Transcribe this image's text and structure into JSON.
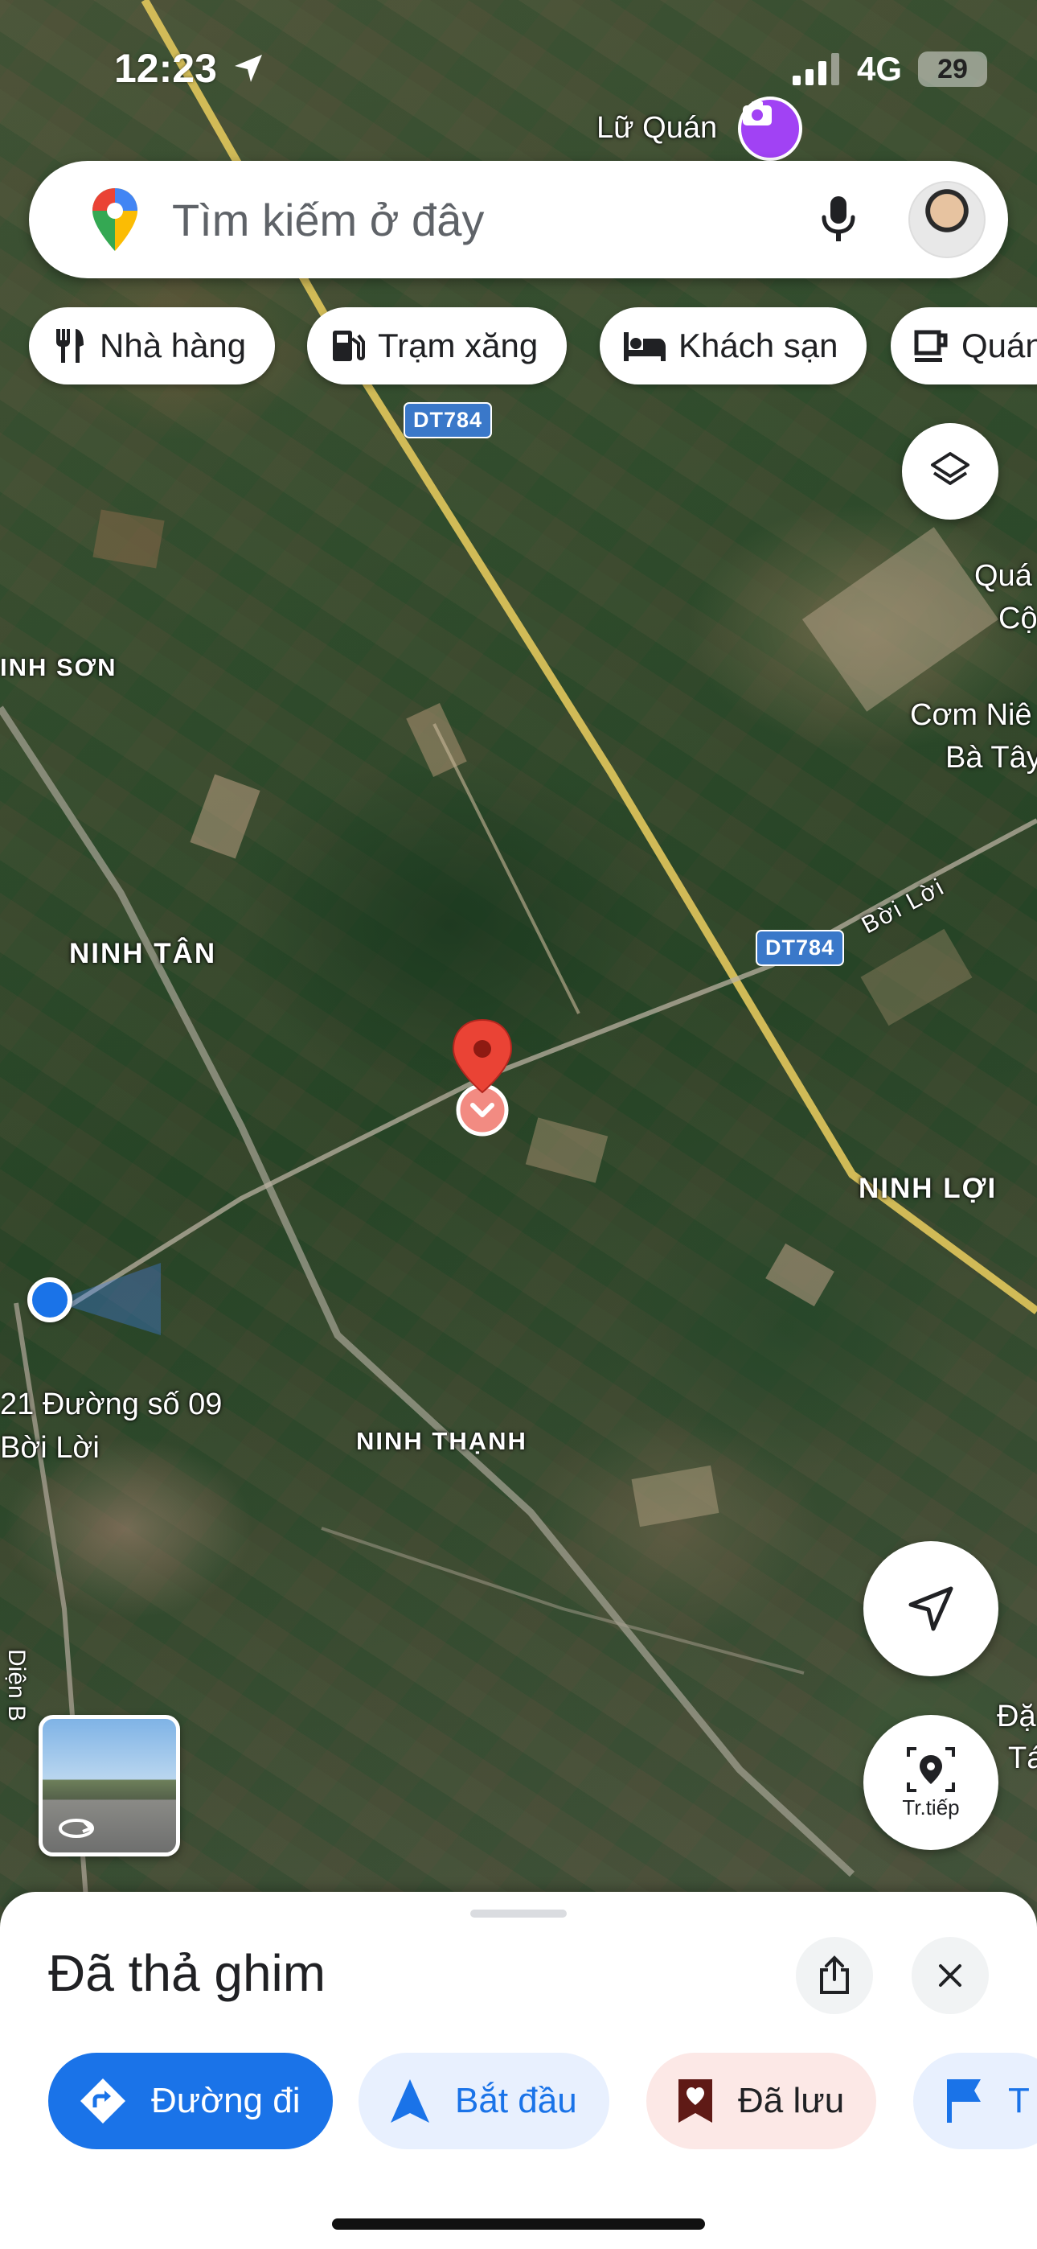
{
  "status_bar": {
    "time": "12:23",
    "network": "4G",
    "battery": "29"
  },
  "search": {
    "placeholder": "Tìm kiếm ở đây"
  },
  "chips": [
    {
      "label": "Nhà hàng",
      "icon": "fork-knife-icon"
    },
    {
      "label": "Trạm xăng",
      "icon": "gas-pump-icon"
    },
    {
      "label": "Khách sạn",
      "icon": "bed-icon"
    },
    {
      "label": "Quán",
      "icon": "coffee-cup-icon"
    }
  ],
  "map_labels": {
    "lu_quan": "Lữ Quán",
    "dt784_top": "DT784",
    "dt784_mid": "DT784",
    "boi_loi_road": "Bời Lời",
    "inh_son": "INH SƠN",
    "ninh_tan": "NINH TÂN",
    "ninh_loi": "NINH LỢI",
    "ninh_thanh": "NINH THẠNH",
    "address_line1": "21 Đường số 09",
    "address_line2": "Bời Lời",
    "quan_line1": "Quá",
    "quan_line2": "Cộ",
    "com_nieu_line1": "Cơm Niê",
    "com_nieu_line2": "Bà Tây",
    "dien": "Diện B",
    "dat_line1": "Đặ",
    "dat_line2": "Tá"
  },
  "live_button": {
    "label": "Tr.tiếp"
  },
  "sheet": {
    "title": "Đã thả ghim",
    "actions": [
      {
        "label": "Đường đi",
        "style": "primary"
      },
      {
        "label": "Bắt đầu",
        "style": "secondary"
      },
      {
        "label": "Đã lưu",
        "style": "saved"
      },
      {
        "label": "T",
        "style": "secondary"
      }
    ]
  },
  "colors": {
    "primary_blue": "#1a73e8",
    "secondary_bg": "#e8f0fe",
    "saved_bg": "#fce8e6",
    "pin_red": "#ea4335",
    "location_dot": "#1a73e8"
  }
}
